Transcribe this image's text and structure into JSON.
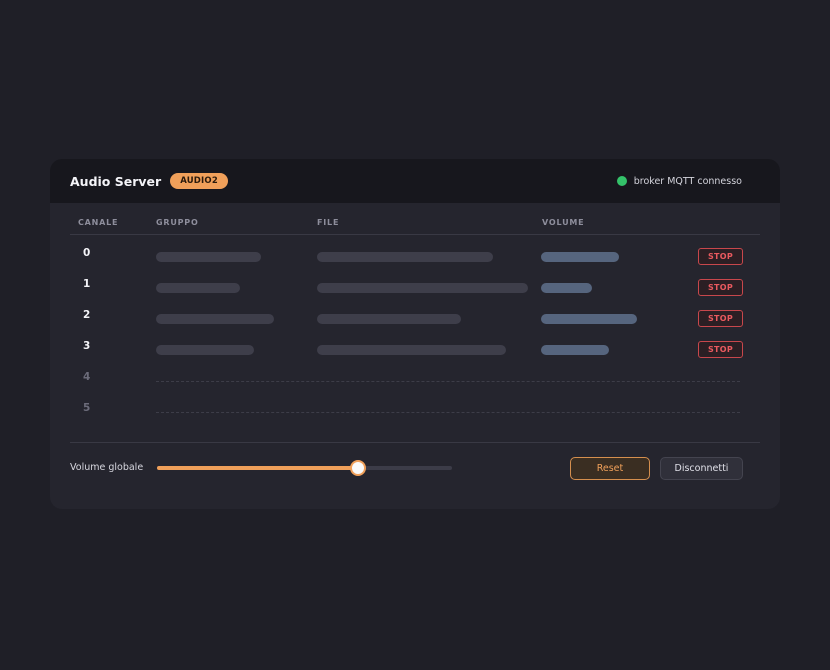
{
  "header": {
    "title": "Audio Server",
    "badge": "AUDIO2",
    "status_text": "broker MQTT connesso",
    "status_color": "#34c26a"
  },
  "table": {
    "columns": [
      "CANALE",
      "GRUPPO",
      "FILE",
      "VOLUME"
    ],
    "rows": [
      {
        "channel": "0",
        "active": true,
        "action": "STOP"
      },
      {
        "channel": "1",
        "active": true,
        "action": "STOP"
      },
      {
        "channel": "2",
        "active": true,
        "action": "STOP"
      },
      {
        "channel": "3",
        "active": true,
        "action": "STOP"
      },
      {
        "channel": "4",
        "active": false
      },
      {
        "channel": "5",
        "active": false
      }
    ]
  },
  "footer": {
    "volume_label": "Volume globale",
    "volume_fraction": 0.68,
    "reset_label": "Reset",
    "disconnect_label": "Disconnetti"
  },
  "colors": {
    "accent": "#f0a05a",
    "danger": "#ea5a5f",
    "background": "#1f1f27",
    "card": "#25252e"
  }
}
